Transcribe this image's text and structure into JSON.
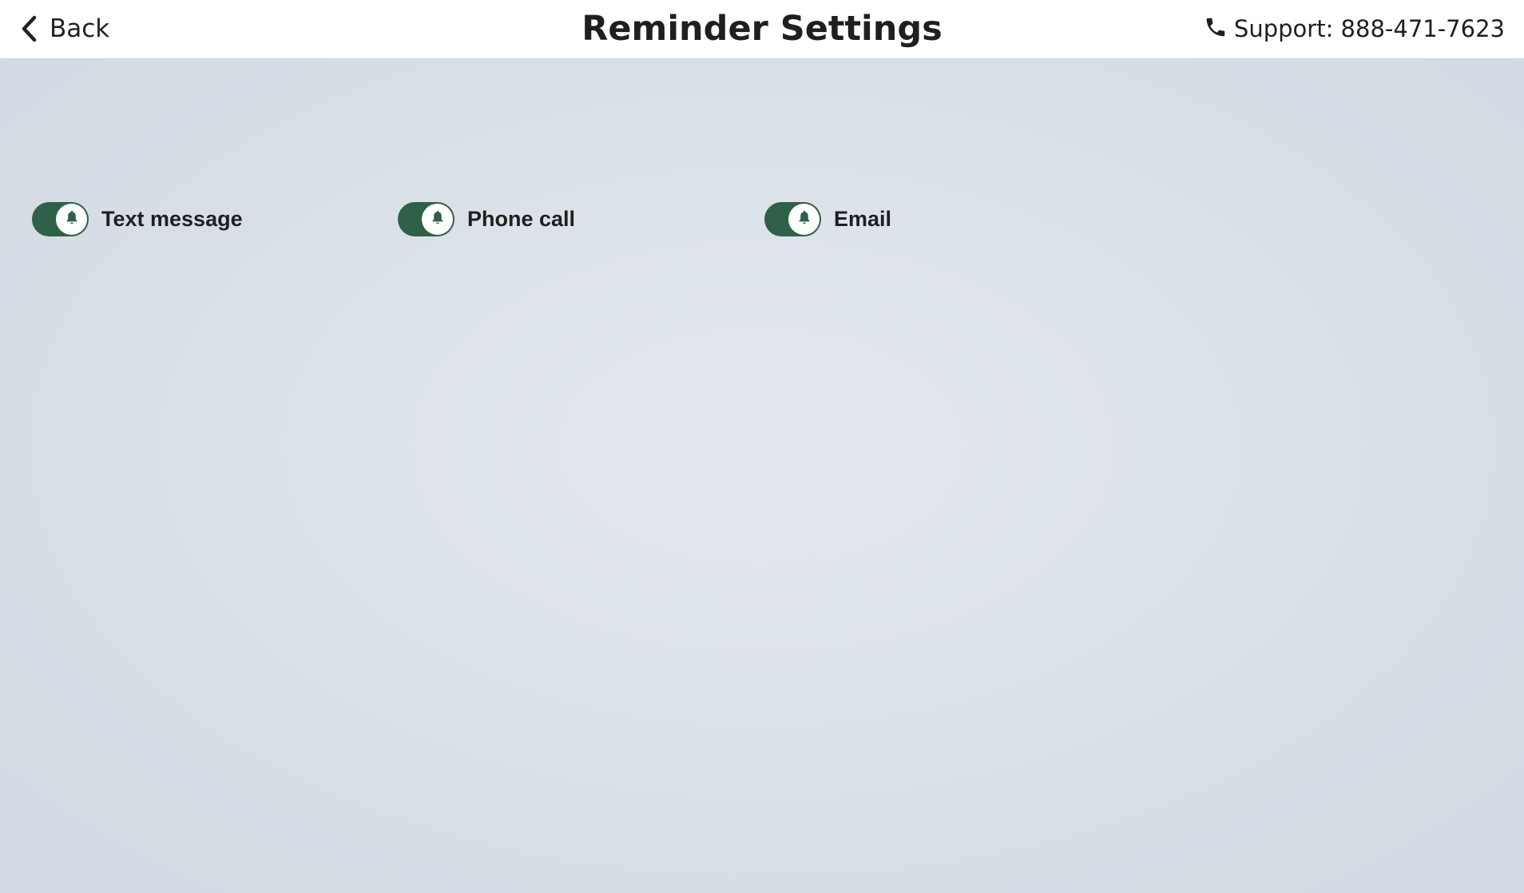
{
  "header": {
    "back_label": "Back",
    "title": "Reminder Settings",
    "support_text": "Support: 888-471-7623",
    "back_icon": "chevron-left-icon",
    "support_icon": "phone-icon"
  },
  "reminders": {
    "items": [
      {
        "label": "Text message",
        "enabled": true,
        "icon": "bell-icon"
      },
      {
        "label": "Phone call",
        "enabled": true,
        "icon": "bell-icon"
      },
      {
        "label": "Email",
        "enabled": true,
        "icon": "bell-icon"
      }
    ]
  },
  "colors": {
    "toggle_on": "#2e6148",
    "header_bg": "#ffffff",
    "page_bg": "#d8dee6",
    "text": "#1f1f1f"
  }
}
